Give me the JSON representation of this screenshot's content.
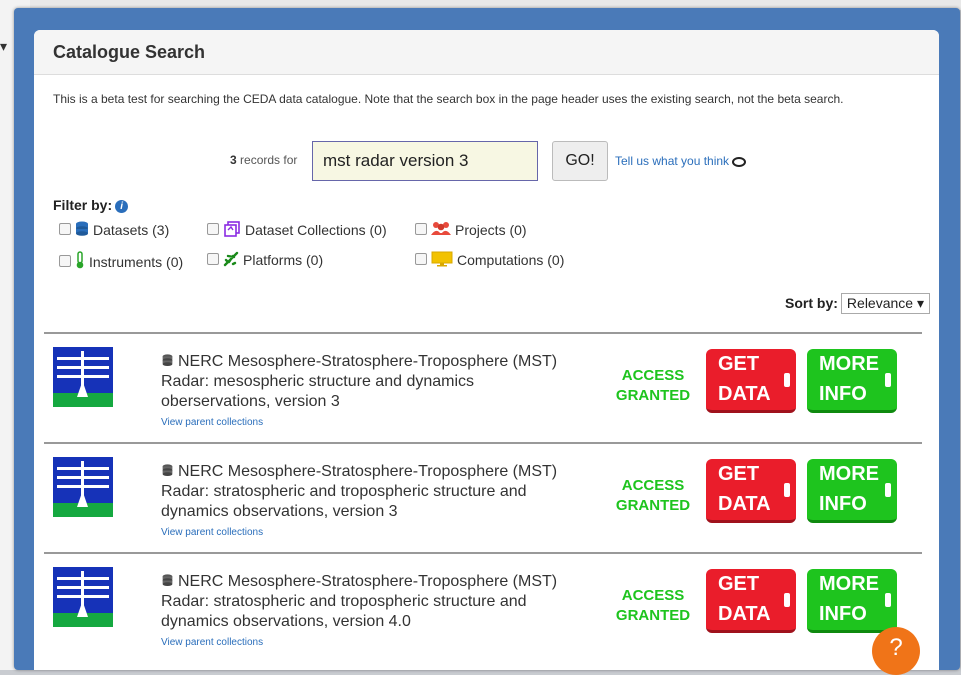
{
  "background": {
    "chevron": "▾"
  },
  "panel": {
    "title": "Catalogue Search",
    "intro": "This is a beta test for searching the CEDA data catalogue. Note that the search box in the page header uses the existing search, not the beta search."
  },
  "search": {
    "record_count": "3",
    "records_for": "records for",
    "query": "mst radar version 3",
    "go_label": "GO!",
    "feedback_link": "Tell us what you think"
  },
  "filters": {
    "label": "Filter by:",
    "options": [
      {
        "label": "Datasets (3)",
        "icon": "database-icon"
      },
      {
        "label": "Dataset Collections (0)",
        "icon": "collections-icon"
      },
      {
        "label": "Projects (0)",
        "icon": "people-icon"
      },
      {
        "label": "Instruments (0)",
        "icon": "thermometer-icon"
      },
      {
        "label": "Platforms (0)",
        "icon": "airplane-icon"
      },
      {
        "label": "Computations (0)",
        "icon": "monitor-icon"
      }
    ]
  },
  "sort": {
    "label": "Sort by:",
    "value": "Relevance ▾"
  },
  "results": [
    {
      "title": "NERC Mesosphere-Stratosphere-Troposphere (MST) Radar: mesospheric structure and dynamics oberservations, version 3",
      "parent_link": "View parent collections",
      "access": [
        "ACCESS",
        "GRANTED"
      ],
      "get": [
        "GET",
        "DATA"
      ],
      "more": [
        "MORE",
        "INFO"
      ]
    },
    {
      "title": "NERC Mesosphere-Stratosphere-Troposphere (MST) Radar: stratospheric and tropospheric structure and dynamics observations, version 3",
      "parent_link": "View parent collections",
      "access": [
        "ACCESS",
        "GRANTED"
      ],
      "get": [
        "GET",
        "DATA"
      ],
      "more": [
        "MORE",
        "INFO"
      ]
    },
    {
      "title": "NERC Mesosphere-Stratosphere-Troposphere (MST) Radar: stratospheric and tropospheric structure and dynamics observations, version 4.0",
      "parent_link": "View parent collections",
      "access": [
        "ACCESS",
        "GRANTED"
      ],
      "get": [
        "GET",
        "DATA"
      ],
      "more": [
        "MORE",
        "INFO"
      ]
    }
  ],
  "help_button": "?",
  "colors": {
    "frame": "#4a7ab8",
    "access": "#1ec41e",
    "get_data": "#ea1d2b",
    "more_info": "#1ec41e",
    "link": "#2a6ebb",
    "help": "#f07418"
  }
}
